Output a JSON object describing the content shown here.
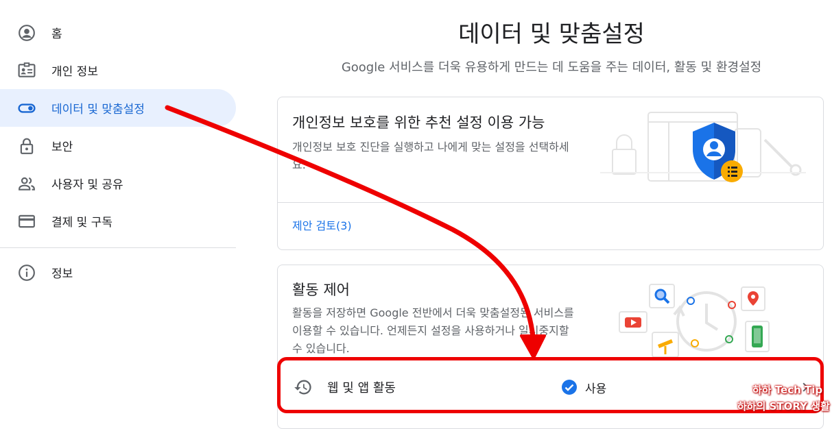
{
  "sidebar": {
    "items": [
      {
        "label": "홈",
        "icon": "account-circle-icon"
      },
      {
        "label": "개인 정보",
        "icon": "id-card-icon"
      },
      {
        "label": "데이터 및 맞춤설정",
        "icon": "toggle-icon",
        "active": true
      },
      {
        "label": "보안",
        "icon": "lock-icon"
      },
      {
        "label": "사용자 및 공유",
        "icon": "people-icon"
      },
      {
        "label": "결제 및 구독",
        "icon": "credit-card-icon"
      },
      {
        "label": "정보",
        "icon": "info-icon"
      }
    ]
  },
  "main": {
    "title": "데이터 및 맞춤설정",
    "subtitle": "Google 서비스를 더욱 유용하게 만드는 데 도움을 주는 데이터, 활동 및 환경설정"
  },
  "privacy_card": {
    "title": "개인정보 보호를 위한 추천 설정 이용 가능",
    "description": "개인정보 보호 진단을 실행하고 나에게 맞는 설정을 선택하세요.",
    "link": "제안 검토(3)"
  },
  "activity_card": {
    "title": "활동 제어",
    "description": "활동을 저장하면 Google 전반에서 더욱 맞춤설정된 서비스를 이용할 수 있습니다. 언제든지 설정을 사용하거나 일시중지할 수 있습니다.",
    "row": {
      "label": "웹 및 앱 활동",
      "status": "사용"
    }
  },
  "watermark": {
    "line1": "하하 Tech Tip",
    "line2": "하하의 STORY 생활"
  },
  "colors": {
    "accent": "#1a73e8",
    "active_bg": "#e8f0fe",
    "annotation": "#ee0000"
  }
}
